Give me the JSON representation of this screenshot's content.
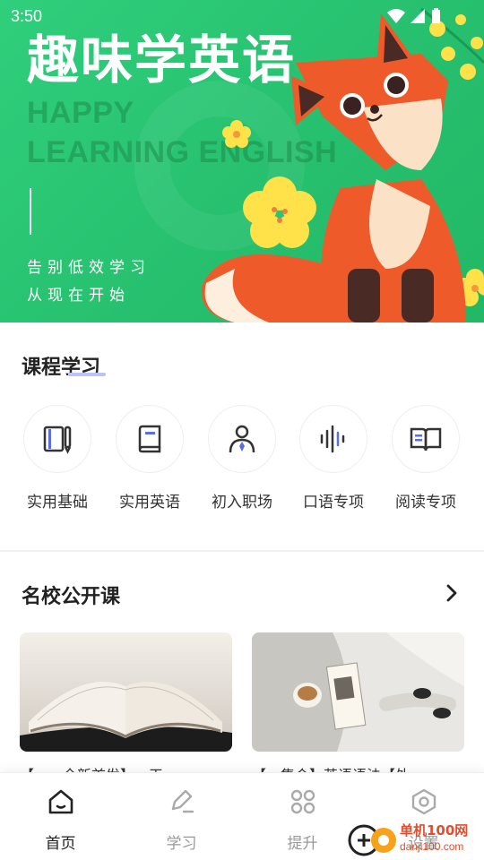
{
  "status_bar": {
    "time": "3:50"
  },
  "banner": {
    "title": "趣味学英语",
    "english_line1": "HAPPY",
    "english_line2": "LEARNING ENGLISH",
    "slogan_line1": "告别低效学习",
    "slogan_line2": "从现在开始"
  },
  "courses": {
    "title": "课程学习",
    "items": [
      {
        "label": "实用基础",
        "icon": "notebook-pen-icon"
      },
      {
        "label": "实用英语",
        "icon": "book-icon"
      },
      {
        "label": "初入职场",
        "icon": "person-tie-icon"
      },
      {
        "label": "口语专项",
        "icon": "voice-wave-icon"
      },
      {
        "label": "阅读专项",
        "icon": "open-book-icon"
      }
    ]
  },
  "public_courses": {
    "title": "名校公开课",
    "cards": [
      {
        "title": "【……全新首发】…天…"
      },
      {
        "title": "【…集合】英语语法【外…"
      }
    ]
  },
  "tabbar": {
    "items": [
      {
        "label": "首页",
        "icon": "home-icon",
        "active": true
      },
      {
        "label": "学习",
        "icon": "pencil-study-icon",
        "active": false
      },
      {
        "label": "提升",
        "icon": "grid-apps-icon",
        "active": false
      },
      {
        "label": "设置",
        "icon": "settings-hexagon-icon",
        "active": false
      }
    ]
  },
  "watermark": {
    "text": "单机100网",
    "url": "danji100.com"
  },
  "colors": {
    "banner_green": "#2fcf7c",
    "accent_blue": "#5a6ee0",
    "fox_orange": "#f0602e"
  }
}
